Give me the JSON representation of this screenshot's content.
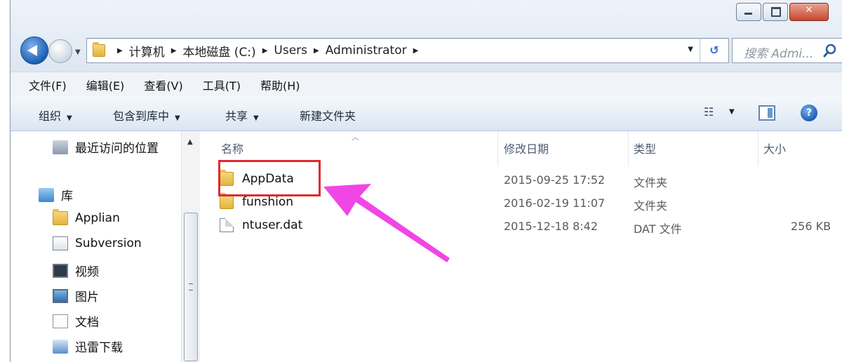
{
  "window": {
    "caption_buttons": [
      "minimize",
      "maximize",
      "close"
    ]
  },
  "address_bar": {
    "crumbs": [
      "计算机",
      "本地磁盘 (C:)",
      "Users",
      "Administrator"
    ]
  },
  "search": {
    "placeholder": "搜索 Admi..."
  },
  "menu": [
    "文件(F)",
    "编辑(E)",
    "查看(V)",
    "工具(T)",
    "帮助(H)"
  ],
  "commands": {
    "organize": "组织",
    "include_library": "包含到库中",
    "share": "共享",
    "new_folder": "新建文件夹"
  },
  "nav_pane": {
    "recent": "最近访问的位置",
    "libraries": "库",
    "items": [
      "Applian",
      "Subversion",
      "视频",
      "图片",
      "文档",
      "迅雷下载"
    ]
  },
  "columns": {
    "name": "名称",
    "date": "修改日期",
    "type": "类型",
    "size": "大小"
  },
  "files": [
    {
      "name": "AppData",
      "date": "2015-09-25 17:52",
      "type": "文件夹",
      "size": "",
      "icon": "folder-icon"
    },
    {
      "name": "funshion",
      "date": "2016-02-19 11:07",
      "type": "文件夹",
      "size": "",
      "icon": "folder-icon"
    },
    {
      "name": "ntuser.dat",
      "date": "2015-12-18 8:42",
      "type": "DAT 文件",
      "size": "256 KB",
      "icon": "file-icon"
    }
  ],
  "annotation": {
    "highlight_color": "#e0292e",
    "arrow_color": "#f046e6",
    "highlighted_item": "AppData"
  }
}
